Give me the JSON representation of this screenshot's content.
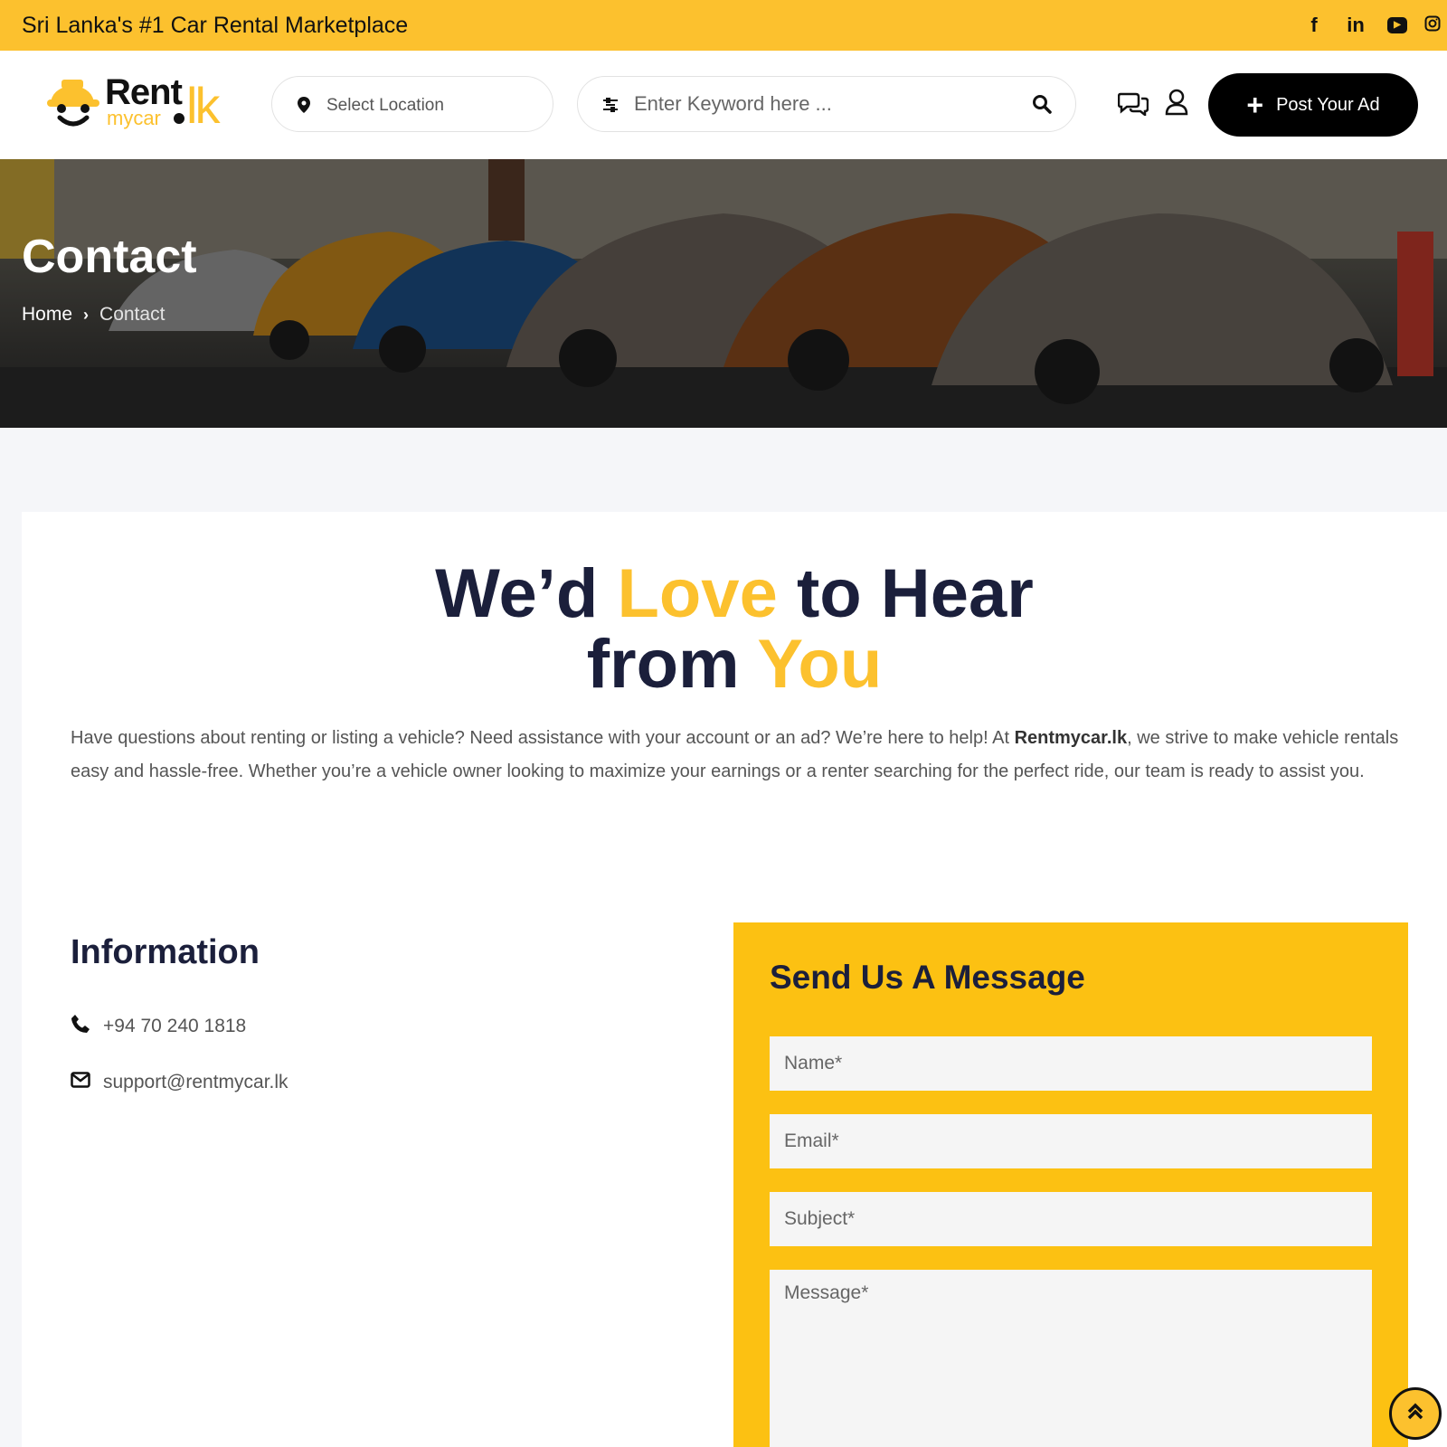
{
  "topbar": {
    "tagline": "Sri Lanka's #1 Car Rental Marketplace",
    "social": [
      "facebook-icon",
      "linkedin-icon",
      "youtube-icon",
      "instagram-icon"
    ],
    "accent_color": "#fcc12e"
  },
  "header": {
    "logo": {
      "rent": "Rent",
      "mycar": "mycar",
      "tld": "lk"
    },
    "location": {
      "label": "Select Location"
    },
    "search": {
      "placeholder": "Enter Keyword here ..."
    },
    "post_ad_label": "Post Your Ad"
  },
  "hero": {
    "title": "Contact",
    "breadcrumb": {
      "home": "Home",
      "current": "Contact"
    }
  },
  "main": {
    "heading": {
      "part1": "We’d ",
      "accent1": "Love",
      "part2": " to Hear",
      "part3": "from ",
      "accent2": "You"
    },
    "intro": {
      "before": "Have questions about renting or listing a vehicle? Need assistance with your account or an ad? We’re here to help! At ",
      "brand": "Rentmycar.lk",
      "after": ", we strive to make vehicle rentals easy and hassle-free. Whether you’re a vehicle owner looking to maximize your earnings or a renter searching for the perfect ride, our team is ready to assist you."
    },
    "information": {
      "title": "Information",
      "phone": "+94 70 240 1818",
      "email": "support@rentmycar.lk"
    },
    "form": {
      "title": "Send Us A Message",
      "name_placeholder": "Name*",
      "email_placeholder": "Email*",
      "subject_placeholder": "Subject*",
      "message_placeholder": "Message*",
      "background_color": "#fcc112"
    }
  }
}
